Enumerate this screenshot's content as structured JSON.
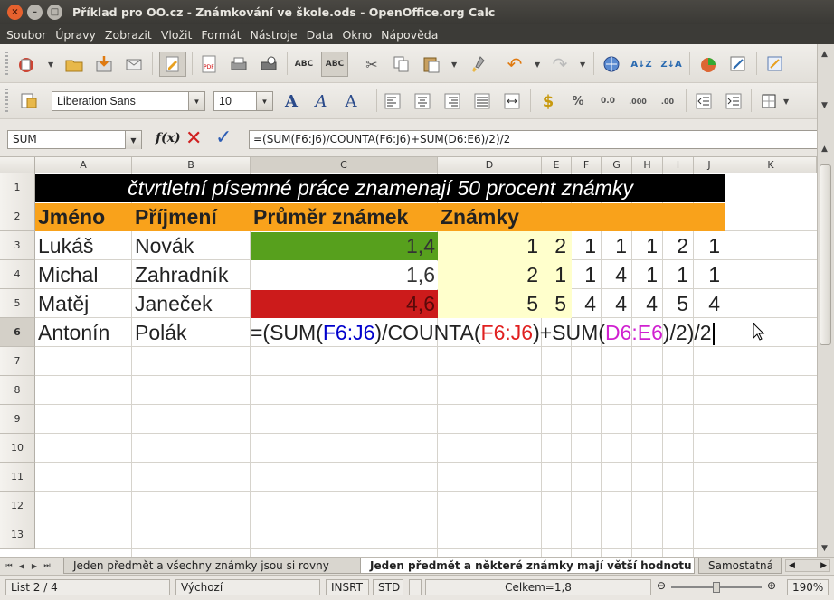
{
  "window": {
    "title": "Příklad pro OO.cz - Známkování ve škole.ods - OpenOffice.org Calc"
  },
  "menu": [
    "Soubor",
    "Úpravy",
    "Zobrazit",
    "Vložit",
    "Formát",
    "Nástroje",
    "Data",
    "Okno",
    "Nápověda"
  ],
  "format_toolbar": {
    "font_name": "Liberation Sans",
    "font_size": "10"
  },
  "formula_bar": {
    "name_box": "SUM",
    "formula": "=(SUM(F6:J6)/COUNTA(F6:J6)+SUM(D6:E6)/2)/2"
  },
  "columns": [
    "A",
    "B",
    "C",
    "D",
    "E",
    "F",
    "G",
    "H",
    "I",
    "J",
    "K"
  ],
  "rows": [
    "1",
    "2",
    "3",
    "4",
    "5",
    "6",
    "7",
    "8",
    "9",
    "10",
    "11",
    "12",
    "13"
  ],
  "sheet": {
    "banner": "čtvrtletní písemné práce znamenají 50 procent známky",
    "headers": {
      "jmeno": "Jméno",
      "prijmeni": "Příjmení",
      "prumer": "Průměr známek",
      "znamky": "Známky"
    },
    "students": [
      {
        "first": "Lukáš",
        "last": "Novák",
        "avg": "1,4",
        "grades": [
          "1",
          "2",
          "1",
          "1",
          "1",
          "2",
          "1"
        ],
        "avg_color": "#57a01d"
      },
      {
        "first": "Michal",
        "last": "Zahradník",
        "avg": "1,6",
        "grades": [
          "2",
          "1",
          "1",
          "4",
          "1",
          "1",
          "1"
        ],
        "avg_color": "#ffffff"
      },
      {
        "first": "Matěj",
        "last": "Janeček",
        "avg": "4,6",
        "grades": [
          "5",
          "5",
          "4",
          "4",
          "4",
          "5",
          "4"
        ],
        "avg_color": "#cc1b1b"
      },
      {
        "first": "Antonín",
        "last": "Polák"
      }
    ],
    "editing_formula": {
      "p1": "=(SUM(",
      "r1": "F6:J6",
      "p2": ")/COUNTA(",
      "r2": "F6:J6",
      "p3": ")+SUM(",
      "r3": "D6:E6",
      "p4": ")/2)/2"
    }
  },
  "tabs": [
    "Jeden předmět a všechny známky jsou si rovny",
    "Jeden předmět a některé známky mají větší hodnotu",
    "Samostatná"
  ],
  "status": {
    "sheet": "List 2 / 4",
    "style": "Výchozí",
    "insert_mode": "INSRT",
    "selection_mode": "STD",
    "sum": "Celkem=1,8",
    "zoom": "190%"
  },
  "colors": {
    "banner_bg": "#000000",
    "header_bg": "#f9a21b",
    "grades_bg": "#ffffcc"
  }
}
